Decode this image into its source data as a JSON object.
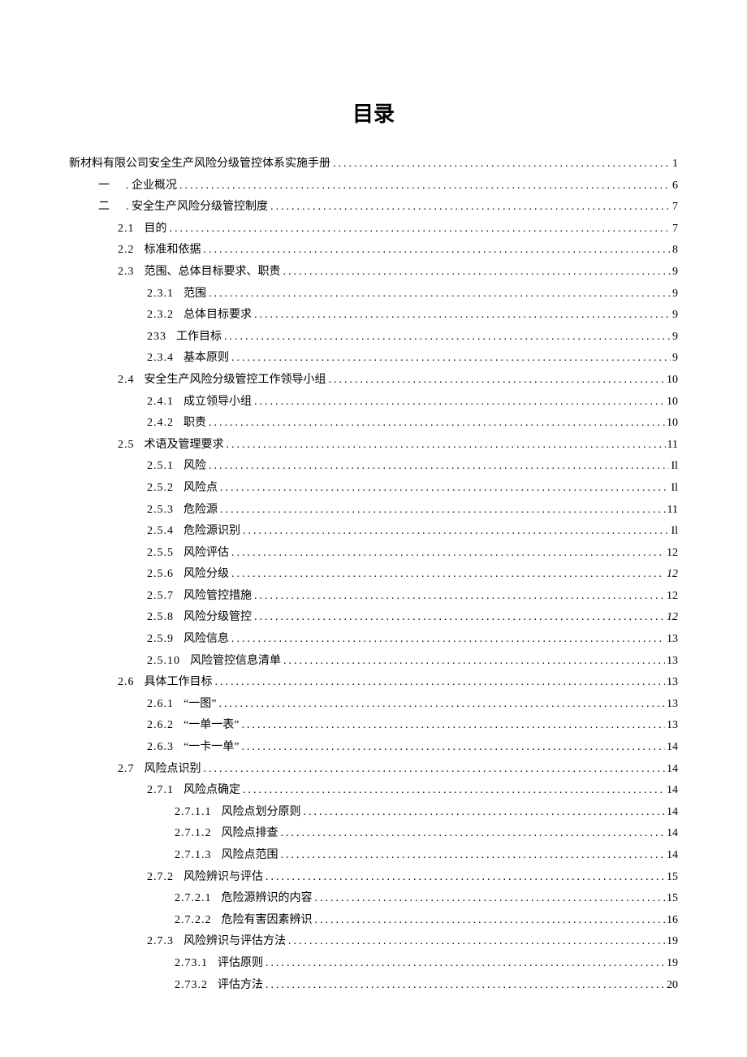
{
  "title": "目录",
  "entries": [
    {
      "level": 0,
      "num": "",
      "text": "新材料有限公司安全生产风险分级管控体系实施手册",
      "page": "1"
    },
    {
      "level": 1,
      "num": "一",
      "text": ". 企业概况",
      "page": "6",
      "cn": true
    },
    {
      "level": 1,
      "num": "二",
      "text": ". 安全生产风险分级管控制度",
      "page": "7",
      "cn": true
    },
    {
      "level": 2,
      "num": "2.1",
      "text": "目的",
      "page": "7"
    },
    {
      "level": 2,
      "num": "2.2",
      "text": "标准和依据",
      "page": "8"
    },
    {
      "level": 2,
      "num": "2.3",
      "text": "范围、总体目标要求、职责",
      "page": "9"
    },
    {
      "level": 3,
      "num": "2.3.1",
      "text": "范围",
      "page": "9"
    },
    {
      "level": 3,
      "num": "2.3.2",
      "text": "总体目标要求",
      "page": "9"
    },
    {
      "level": 3,
      "num": "233",
      "text": "工作目标",
      "page": "9"
    },
    {
      "level": 3,
      "num": "2.3.4",
      "text": "基本原则",
      "page": "9"
    },
    {
      "level": 2,
      "num": "2.4",
      "text": "安全生产风险分级管控工作领导小组",
      "page": "10"
    },
    {
      "level": 3,
      "num": "2.4.1",
      "text": "成立领导小组",
      "page": "10"
    },
    {
      "level": 3,
      "num": "2.4.2",
      "text": "职责",
      "page": "10"
    },
    {
      "level": 2,
      "num": "2.5",
      "text": "术语及管理要求",
      "page": "11"
    },
    {
      "level": 3,
      "num": "2.5.1",
      "text": "风险",
      "page": "Il"
    },
    {
      "level": 3,
      "num": "2.5.2",
      "text": "风险点",
      "page": "Il"
    },
    {
      "level": 3,
      "num": "2.5.3",
      "text": "危险源",
      "page": "11"
    },
    {
      "level": 3,
      "num": "2.5.4",
      "text": "危险源识别",
      "page": "Il"
    },
    {
      "level": 3,
      "num": "2.5.5",
      "text": "风险评估",
      "page": "12"
    },
    {
      "level": 3,
      "num": "2.5.6",
      "text": "风险分级",
      "page": "12",
      "italic": true
    },
    {
      "level": 3,
      "num": "2.5.7",
      "text": "风险管控措施",
      "page": "12"
    },
    {
      "level": 3,
      "num": "2.5.8",
      "text": "风险分级管控",
      "page": "12",
      "italic": true
    },
    {
      "level": 3,
      "num": "2.5.9",
      "text": "风险信息",
      "page": "13"
    },
    {
      "level": 3,
      "num": "2.5.10",
      "text": "风险管控信息清单",
      "page": "13"
    },
    {
      "level": 2,
      "num": "2.6",
      "text": "具体工作目标",
      "page": "13"
    },
    {
      "level": 3,
      "num": "2.6.1",
      "text": "“一图”",
      "page": "13"
    },
    {
      "level": 3,
      "num": "2.6.2",
      "text": "“一单一表”",
      "page": "13"
    },
    {
      "level": 3,
      "num": "2.6.3",
      "text": "“一卡一单”",
      "page": "14"
    },
    {
      "level": 2,
      "num": "2.7",
      "text": "风险点识别",
      "page": "14"
    },
    {
      "level": 3,
      "num": "2.7.1",
      "text": "风险点确定",
      "page": "14"
    },
    {
      "level": 4,
      "num": "2.7.1.1",
      "text": "风险点划分原则",
      "page": "14"
    },
    {
      "level": 4,
      "num": "2.7.1.2",
      "text": "风险点排查",
      "page": "14"
    },
    {
      "level": 4,
      "num": "2.7.1.3",
      "text": "风险点范围",
      "page": "14"
    },
    {
      "level": 3,
      "num": "2.7.2",
      "text": "风险辨识与评估",
      "page": "15"
    },
    {
      "level": 4,
      "num": "2.7.2.1",
      "text": "危险源辨识的内容",
      "page": "15"
    },
    {
      "level": 4,
      "num": "2.7.2.2",
      "text": "危险有害因素辨识",
      "page": "16"
    },
    {
      "level": 3,
      "num": "2.7.3",
      "text": "风险辨识与评估方法",
      "page": "19"
    },
    {
      "level": 4,
      "num": "2.73.1",
      "text": "评估原则",
      "page": "19"
    },
    {
      "level": 4,
      "num": "2.73.2",
      "text": "评估方法",
      "page": "20"
    }
  ]
}
